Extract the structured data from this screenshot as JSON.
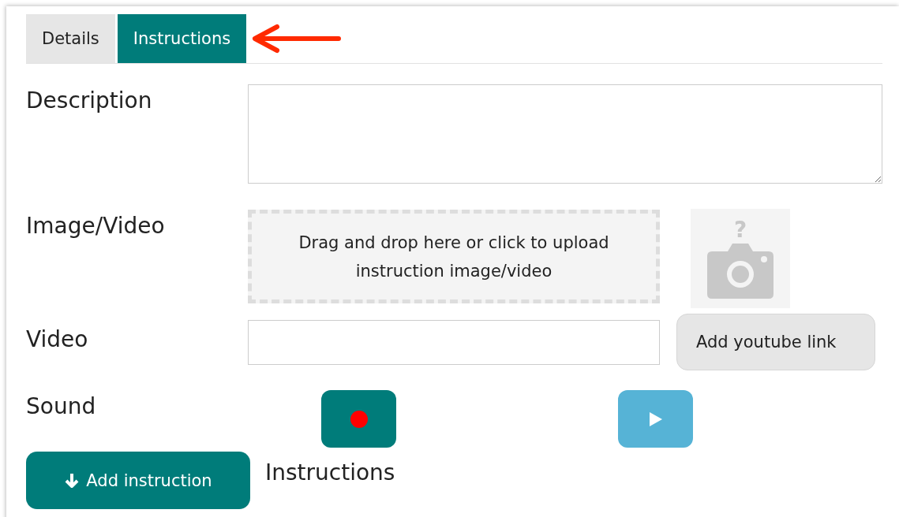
{
  "tabs": [
    {
      "label": "Details",
      "selected": false
    },
    {
      "label": "Instructions",
      "selected": true
    }
  ],
  "fields": [
    {
      "kind": "textarea",
      "label": "Description"
    },
    {
      "kind": "dropzone",
      "label": "Image/Video",
      "hint": "Drag and drop here or click to upload instruction image/video",
      "placeholder_mark": "?"
    },
    {
      "kind": "link",
      "label": "Video",
      "button": "Add youtube link"
    },
    {
      "kind": "sound",
      "label": "Sound"
    }
  ],
  "add_button": "Add instruction",
  "heading": "Instructions"
}
